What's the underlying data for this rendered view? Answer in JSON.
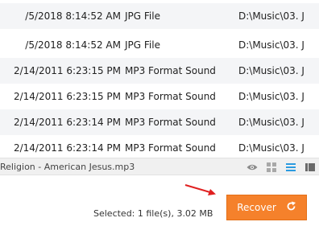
{
  "file_list": {
    "rows": [
      {
        "date": "/5/2018 8:14:52 AM",
        "type": "JPG File",
        "path": "D:\\Music\\03. J"
      },
      {
        "date": "/5/2018 8:14:52 AM",
        "type": "JPG File",
        "path": "D:\\Music\\03. J"
      },
      {
        "date": "2/14/2011 6:23:15 PM",
        "type": "MP3 Format Sound",
        "path": "D:\\Music\\03. J"
      },
      {
        "date": "2/14/2011 6:23:15 PM",
        "type": "MP3 Format Sound",
        "path": "D:\\Music\\03. J"
      },
      {
        "date": "2/14/2011 6:23:14 PM",
        "type": "MP3 Format Sound",
        "path": "D:\\Music\\03. J"
      },
      {
        "date": "2/14/2011 6:23:14 PM",
        "type": "MP3 Format Sound",
        "path": "D:\\Music\\03. J"
      }
    ]
  },
  "preview_bar": {
    "file_name": "Religion - American Jesus.mp3",
    "tools": [
      {
        "icon": "eye-icon",
        "color": "#8a8a8a"
      },
      {
        "icon": "thumbnail-view-icon",
        "color": "#9a9a9a"
      },
      {
        "icon": "list-view-icon",
        "color": "#2b9be0"
      },
      {
        "icon": "detail-view-icon",
        "color": "#6a6a6a"
      }
    ]
  },
  "footer": {
    "selected_text": "Selected: 1 file(s), 3.02 MB",
    "recover_label": "Recover",
    "recover_color": "#f5812b",
    "arrow_color": "#e02020"
  }
}
